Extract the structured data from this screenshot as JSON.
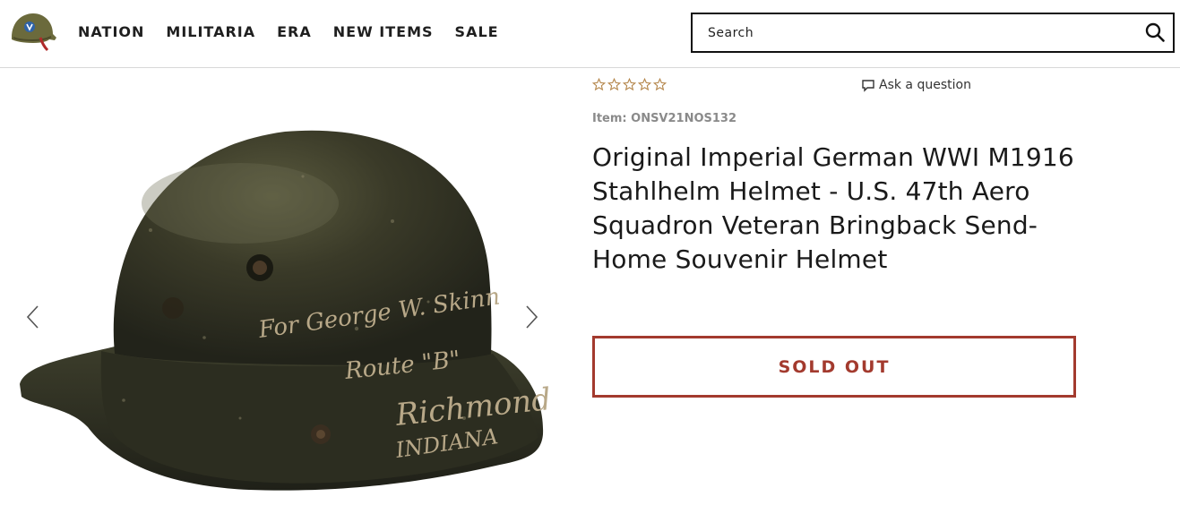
{
  "header": {
    "nav": [
      {
        "label": "NATION"
      },
      {
        "label": "MILITARIA"
      },
      {
        "label": "ERA"
      },
      {
        "label": "NEW ITEMS"
      },
      {
        "label": "SALE"
      }
    ],
    "search": {
      "placeholder": "Search",
      "value": ""
    }
  },
  "gallery": {
    "helmet_inscription": [
      "For George W. Skinn",
      "Route \"B\"",
      "Richmond",
      "INDIANA"
    ]
  },
  "product": {
    "rating_stars": 0,
    "rating_max": 5,
    "ask_label": "Ask a question",
    "sku_label": "Item: ONSV21NOS132",
    "title": "Original Imperial German WWI M1916 Stahlhelm Helmet - U.S. 47th Aero Squadron Veteran Bringback Send-Home Souvenir Helmet",
    "button_label": "SOLD OUT"
  },
  "colors": {
    "accent": "#a33a2e",
    "star_outline": "#b5874c",
    "text": "#1a1a1a",
    "muted": "#8a8a8a"
  }
}
